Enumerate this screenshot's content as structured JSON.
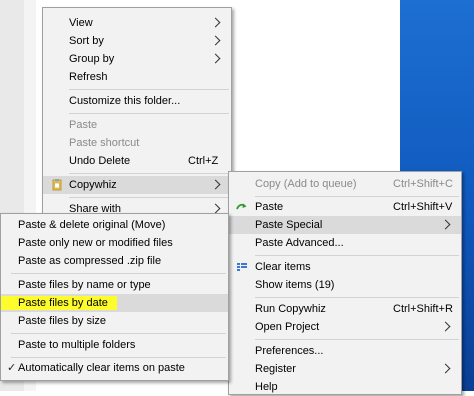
{
  "context_menu": {
    "items": [
      {
        "label": "View",
        "submenu": true
      },
      {
        "label": "Sort by",
        "submenu": true
      },
      {
        "label": "Group by",
        "submenu": true
      },
      {
        "label": "Refresh"
      },
      {
        "label": "Customize this folder..."
      },
      {
        "label": "Paste",
        "disabled": true
      },
      {
        "label": "Paste shortcut",
        "disabled": true
      },
      {
        "label": "Undo Delete",
        "shortcut": "Ctrl+Z"
      },
      {
        "label": "Copywhiz",
        "submenu": true,
        "icon": "copywhiz-icon"
      },
      {
        "label": "Share with",
        "submenu": true
      }
    ]
  },
  "copywhiz_menu": {
    "items": [
      {
        "label": "Copy (Add to queue)",
        "shortcut": "Ctrl+Shift+C",
        "disabled": true
      },
      {
        "label": "Paste",
        "shortcut": "Ctrl+Shift+V",
        "icon": "green-arrow-icon"
      },
      {
        "label": "Paste Special",
        "submenu": true
      },
      {
        "label": "Paste Advanced..."
      },
      {
        "label": "Clear items",
        "icon": "clear-items-icon"
      },
      {
        "label": "Show items (19)"
      },
      {
        "label": "Run Copywhiz",
        "shortcut": "Ctrl+Shift+R"
      },
      {
        "label": "Open Project",
        "submenu": true
      },
      {
        "label": "Preferences..."
      },
      {
        "label": "Register",
        "submenu": true
      },
      {
        "label": "Help"
      }
    ]
  },
  "paste_special_menu": {
    "items": [
      {
        "label": "Paste & delete original (Move)"
      },
      {
        "label": "Paste only new or modified files"
      },
      {
        "label": "Paste as compressed .zip file"
      },
      {
        "label": "Paste files by name or type"
      },
      {
        "label": "Paste files by date",
        "highlighted": true
      },
      {
        "label": "Paste files by size"
      },
      {
        "label": "Paste to multiple folders"
      },
      {
        "label": "Automatically clear items on paste",
        "checked": true
      }
    ],
    "check_mark": "✓"
  },
  "colors": {
    "highlight": "#fffc2e",
    "desktop": "#0f58bd",
    "menu_bg": "#f2f2f2"
  }
}
